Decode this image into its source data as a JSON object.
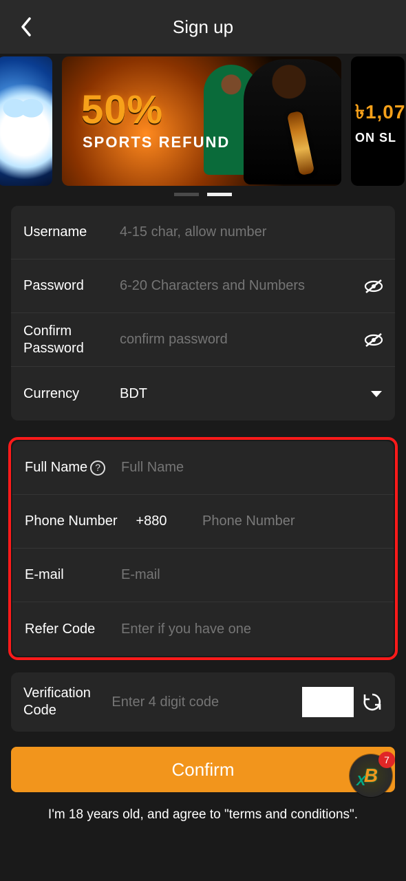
{
  "header": {
    "title": "Sign up"
  },
  "banner": {
    "main_line1": "50%",
    "main_line2": "SPORTS REFUND",
    "right_amount": "৳1,07",
    "right_sub": "ON SL"
  },
  "form1": {
    "username": {
      "label": "Username",
      "placeholder": "4-15 char, allow number",
      "value": ""
    },
    "password": {
      "label": "Password",
      "placeholder": "6-20 Characters and Numbers",
      "value": ""
    },
    "confirm_password": {
      "label": "Confirm Password",
      "placeholder": "confirm password",
      "value": ""
    },
    "currency": {
      "label": "Currency",
      "value": "BDT"
    }
  },
  "form2": {
    "full_name": {
      "label": "Full Name",
      "placeholder": "Full Name",
      "value": ""
    },
    "phone": {
      "label": "Phone Number",
      "prefix": "+880",
      "placeholder": "Phone Number",
      "value": ""
    },
    "email": {
      "label": "E-mail",
      "placeholder": "E-mail",
      "value": ""
    },
    "refer": {
      "label": "Refer Code",
      "placeholder": "Enter if you have one",
      "value": ""
    }
  },
  "verification": {
    "label": "Verification Code",
    "placeholder": "Enter 4 digit code",
    "value": ""
  },
  "confirm_label": "Confirm",
  "agreement": "I'm 18 years old, and agree to \"terms and conditions\".",
  "fab_badge": "7"
}
